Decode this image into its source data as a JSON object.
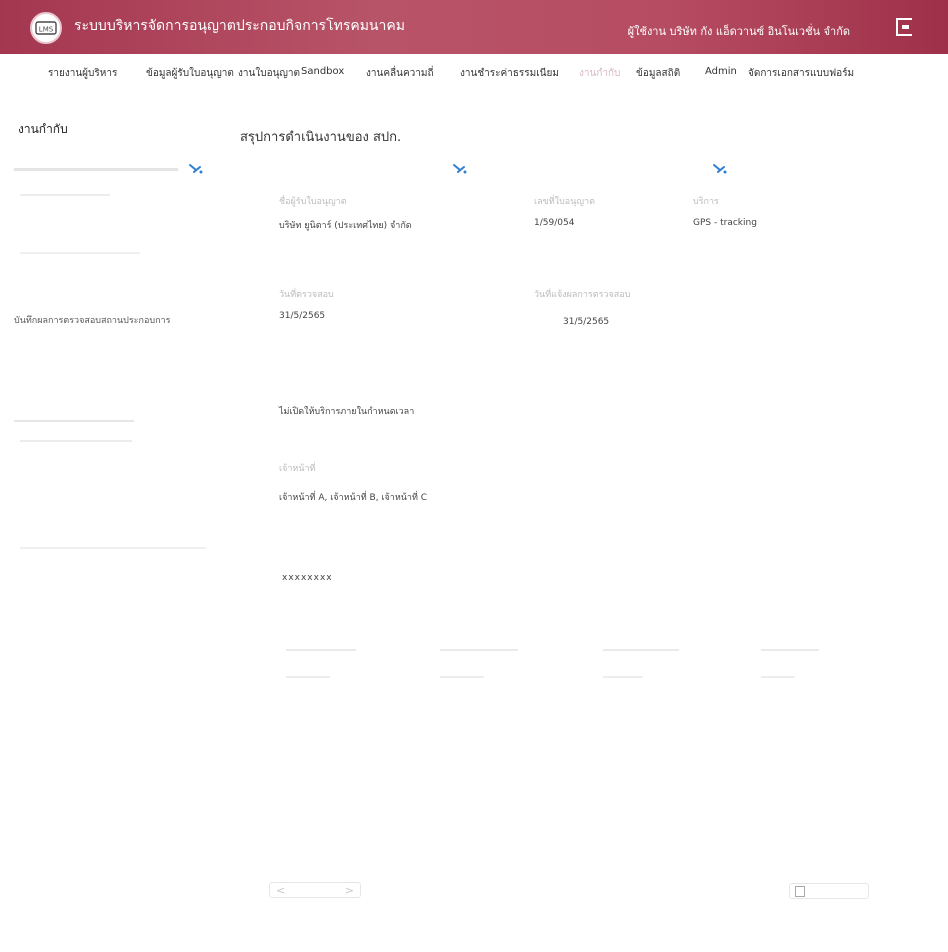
{
  "header": {
    "app_title": "ระบบบริหารจัดการอนุญาตประกอบกิจการโทรคมนาคม",
    "logo_text": "LMS",
    "user_label": "ผู้ใช้งาน บริษัท กัง แอ็ดวานซ์ อินโนเวชั่น จำกัด"
  },
  "nav": [
    "รายงานผู้บริหาร",
    "ข้อมูลผู้รับใบอนุญาต",
    "งานใบอนุญาต",
    "Sandbox",
    "งานคลื่นความถี่",
    "งานชำระค่าธรรมเนียม",
    "งานกำกับ",
    "ข้อมูลสถิติ",
    "Admin",
    "จัดการเอกสารแบบฟอร์ม"
  ],
  "sidebar": {
    "title": "งานกำกับ",
    "link": "บันทึกผลการตรวจสอบสถานประกอบการ"
  },
  "main": {
    "title": "สรุปการดำเนินงานของ สปก."
  },
  "fields": {
    "licensee_label": "ชื่อผู้รับใบอนุญาต",
    "licensee_value": "บริษัท ยูนิตาร์ (ประเทศไทย) จำกัด",
    "license_no_label": "เลขที่ใบอนุญาต",
    "license_no_value": "1/59/054",
    "service_label": "บริการ",
    "service_value": "GPS - tracking",
    "inspect_date_label": "วันที่ตรวจสอบ",
    "inspect_date_value": "31/5/2565",
    "notice_date_label": "วันที่แจ้งผลการตรวจสอบ",
    "notice_date_value": "31/5/2565",
    "result_value": "ไม่เปิดให้บริการภายในกำหนดเวลา",
    "officer_label": "เจ้าหน้าที่",
    "officer_value": "เจ้าหน้าที่ A, เจ้าหน้าที่ B, เจ้าหน้าที่ C",
    "masked_value": "xxxxxxxx"
  },
  "pager": {
    "prev": "<",
    "next": ">"
  }
}
